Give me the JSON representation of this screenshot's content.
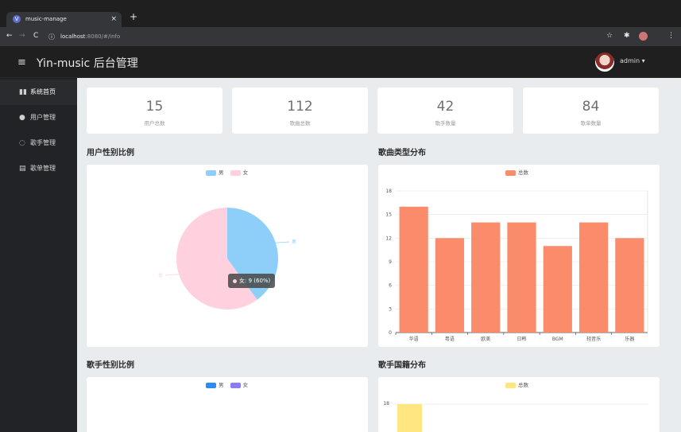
{
  "browser": {
    "tab_title": "music-manage",
    "tab_close": "×",
    "new_tab": "+",
    "url_host": "localhost",
    "url_rest": ":8080/#/info"
  },
  "header": {
    "menu_icon": "≡",
    "title": "Yin-music 后台管理",
    "user": "admin ▾"
  },
  "sidebar": {
    "items": [
      {
        "label": "系统首页",
        "icon": "bar-chart-icon"
      },
      {
        "label": "用户管理",
        "icon": "user-icon"
      },
      {
        "label": "歌手管理",
        "icon": "headset-icon"
      },
      {
        "label": "歌单管理",
        "icon": "document-icon"
      }
    ]
  },
  "stats": [
    {
      "value": "15",
      "label": "用户总数"
    },
    {
      "value": "112",
      "label": "歌曲总数"
    },
    {
      "value": "42",
      "label": "歌手数量"
    },
    {
      "value": "84",
      "label": "歌单数量"
    }
  ],
  "sections": {
    "user_gender": "用户性别比例",
    "song_type": "歌曲类型分布",
    "singer_gender": "歌手性别比例",
    "singer_nation": "歌手国籍分布"
  },
  "chart_data": [
    {
      "type": "pie",
      "legend": [
        "男",
        "女"
      ],
      "slices": [
        {
          "name": "男",
          "value": 6,
          "color": "#8ecffa"
        },
        {
          "name": "女",
          "value": 9,
          "color": "#ffd0de"
        }
      ],
      "tooltip": "女: 9 (60%)",
      "labels": [
        "男",
        "女"
      ]
    },
    {
      "type": "bar",
      "legend": [
        "总数"
      ],
      "color": "#fa8c6c",
      "categories": [
        "华语",
        "粤语",
        "欧美",
        "日韩",
        "BGM",
        "轻音乐",
        "乐器"
      ],
      "values": [
        16,
        12,
        14,
        14,
        11,
        14,
        12
      ],
      "ylim": [
        0,
        18
      ],
      "yticks": [
        "0",
        "3",
        "6",
        "9",
        "12",
        "15",
        "18"
      ]
    },
    {
      "type": "pie",
      "legend": [
        "男",
        "女"
      ],
      "colors": [
        "#2d8cf0",
        "#8a7cf2"
      ]
    },
    {
      "type": "bar",
      "legend": [
        "总数"
      ],
      "color": "#ffe680",
      "yticks": [
        "18"
      ]
    }
  ]
}
